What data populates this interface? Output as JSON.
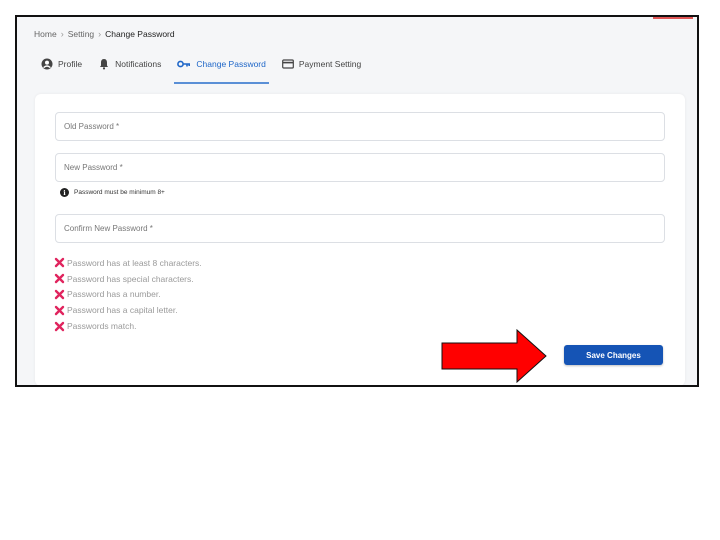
{
  "breadcrumb": {
    "items": [
      "Home",
      "Setting",
      "Change Password"
    ],
    "separator": "›"
  },
  "tabs": [
    {
      "label": "Profile",
      "icon": "user-circle-icon",
      "active": false
    },
    {
      "label": "Notifications",
      "icon": "bell-icon",
      "active": false
    },
    {
      "label": "Change Password",
      "icon": "key-icon",
      "active": true
    },
    {
      "label": "Payment Setting",
      "icon": "credit-card-icon",
      "active": false
    }
  ],
  "form": {
    "old_password": {
      "placeholder": "Old Password *",
      "value": ""
    },
    "new_password": {
      "placeholder": "New Password *",
      "value": ""
    },
    "hint": "Password must be minimum 8+",
    "confirm_password": {
      "placeholder": "Confirm New Password *",
      "value": ""
    },
    "requirements": [
      {
        "text": "Password has at least 8 characters.",
        "met": false
      },
      {
        "text": "Password has special characters.",
        "met": false
      },
      {
        "text": "Password has a number.",
        "met": false
      },
      {
        "text": "Password has a capital letter.",
        "met": false
      },
      {
        "text": "Passwords match.",
        "met": false
      }
    ],
    "save_label": "Save Changes"
  },
  "colors": {
    "accent": "#1e66c8",
    "button": "#1554b5",
    "unmet": "#e0245e",
    "arrow": "#ff0000"
  }
}
